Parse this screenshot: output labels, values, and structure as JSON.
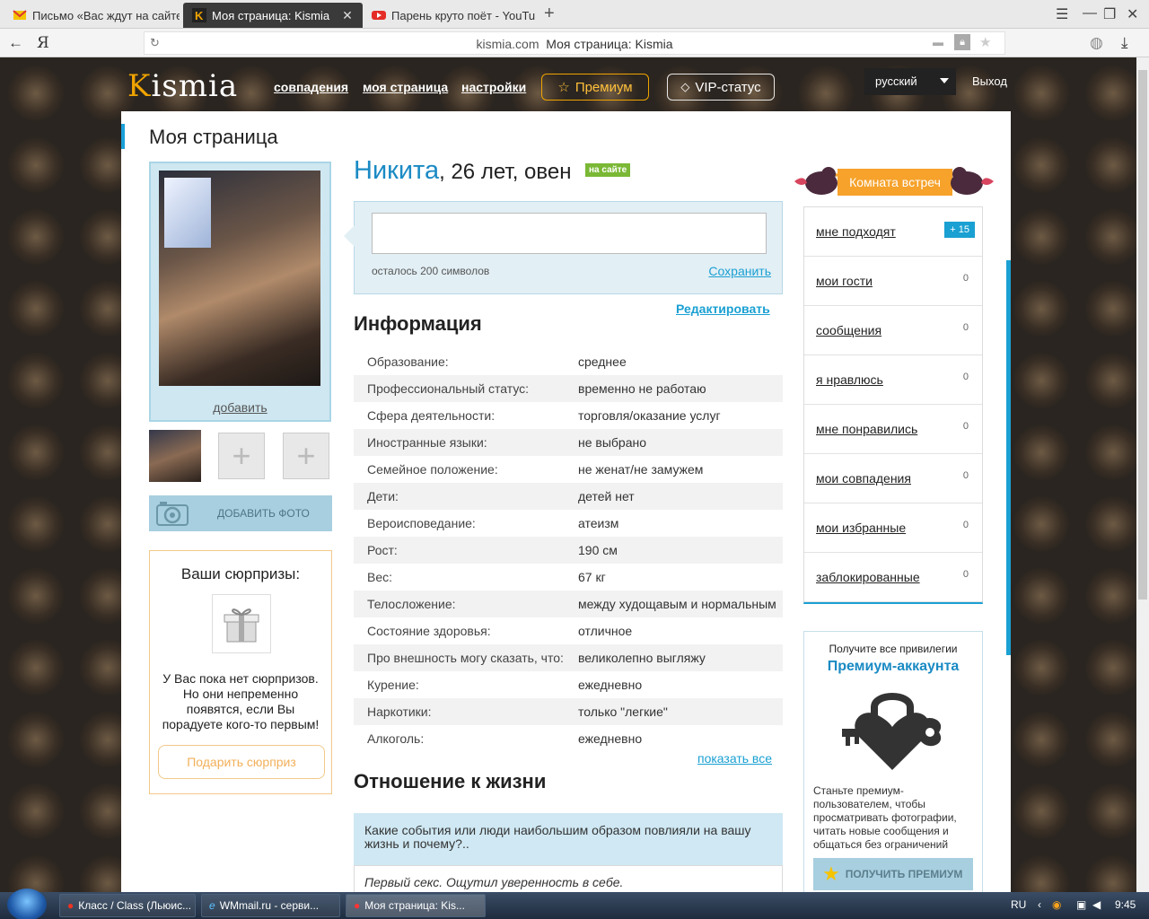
{
  "browser": {
    "tabs": [
      {
        "label": "Письмо «Вас ждут на сайте"
      },
      {
        "label": "Моя страница: Kismia"
      },
      {
        "label": "Парень круто поёт - YouTu"
      }
    ],
    "address_host": "kismia.com",
    "address_title": "Моя страница: Kismia"
  },
  "header": {
    "logo_k": "K",
    "logo_rest": "ismia",
    "nav": [
      "совпадения",
      "моя страница",
      "настройки"
    ],
    "premium": "Премиум",
    "vip": "VIP-статус",
    "language": "русский",
    "logout": "Выход"
  },
  "page_title": "Моя страница",
  "left": {
    "add_link": "добавить",
    "add_photo": "ДОБАВИТЬ ФОТО",
    "surprises_title": "Ваши сюрпризы:",
    "surprises_text": "У Вас пока нет сюрпризов. Но они непременно появятся, если Вы порадуете кого-то первым!",
    "gift_button": "Подарить сюрприз"
  },
  "profile": {
    "name": "Никита",
    "details": ", 26 лет, овен",
    "online": "на сайте",
    "status_remaining": "осталось 200 символов",
    "save": "Сохранить"
  },
  "info": {
    "title": "Информация",
    "edit": "Редактировать",
    "rows": [
      {
        "k": "Образование:",
        "v": "среднее"
      },
      {
        "k": "Профессиональный статус:",
        "v": "временно не работаю"
      },
      {
        "k": "Сфера деятельности:",
        "v": "торговля/оказание услуг"
      },
      {
        "k": "Иностранные языки:",
        "v": "не выбрано"
      },
      {
        "k": "Семейное положение:",
        "v": "не женат/не замужем"
      },
      {
        "k": "Дети:",
        "v": "детей нет"
      },
      {
        "k": "Вероисповедание:",
        "v": "атеизм"
      },
      {
        "k": "Рост:",
        "v": "190 см"
      },
      {
        "k": "Вес:",
        "v": "67 кг"
      },
      {
        "k": "Телосложение:",
        "v": "между худощавым и нормальным"
      },
      {
        "k": "Состояние здоровья:",
        "v": "отличное"
      },
      {
        "k": "Про внешность могу сказать, что:",
        "v": "великолепно выгляжу"
      },
      {
        "k": "Курение:",
        "v": "ежедневно"
      },
      {
        "k": "Наркотики:",
        "v": "только \"легкие\""
      },
      {
        "k": "Алкоголь:",
        "v": "ежедневно"
      }
    ],
    "show_all": "показать все"
  },
  "life": {
    "title": "Отношение к жизни",
    "question": "Какие события или люди наибольшим образом повлияли на вашу жизнь и почему?..",
    "answer": "Первый секс. Ощутил уверенность в себе."
  },
  "right": {
    "room": "Комната встреч",
    "menu": [
      {
        "label": "мне подходят",
        "count": "+ 15"
      },
      {
        "label": "мои гости",
        "count": "0"
      },
      {
        "label": "сообщения",
        "count": "0"
      },
      {
        "label": "я нравлюсь",
        "count": "0"
      },
      {
        "label": "мне понравились",
        "count": "0"
      },
      {
        "label": "мои совпадения",
        "count": "0"
      },
      {
        "label": "мои избранные",
        "count": "0"
      },
      {
        "label": "заблокированные",
        "count": "0"
      }
    ],
    "promo_small": "Получите все привилегии",
    "promo_big": "Премиум-аккаунта",
    "promo_desc": "Станьте премиум-пользователем, чтобы просматривать фотографии, читать новые сообщения и общаться без ограничений",
    "promo_btn": "ПОЛУЧИТЬ ПРЕМИУМ"
  },
  "taskbar": {
    "tasks": [
      "Класс / Class (Льюис...",
      "WMmail.ru - серви...",
      "Моя страница: Kis..."
    ],
    "lang": "RU",
    "time": "9:45"
  },
  "colors": {
    "accent": "#1aa0d2",
    "brand": "#f0a400",
    "online": "#7ab835"
  }
}
